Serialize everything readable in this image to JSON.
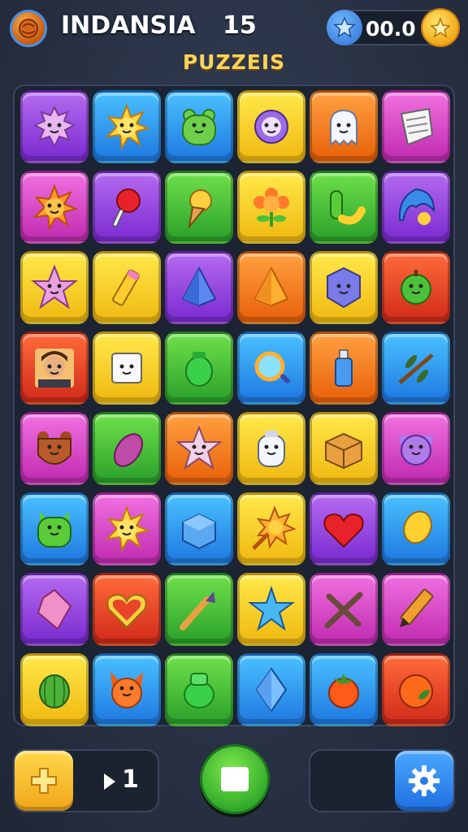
{
  "header": {
    "title": "INDANSIA",
    "level": "15",
    "coins": "00.0",
    "subtitle": "PUZZEIS"
  },
  "colors": {
    "purple": "#9a4ae0",
    "blue": "#2ea0f0",
    "yellow": "#f7d41e",
    "orange": "#f58a1a",
    "pink": "#e854c8",
    "green": "#4cc23a",
    "red": "#e8442a"
  },
  "board": {
    "rows": [
      [
        {
          "color": "purple",
          "icon": "spiky-creature-icon"
        },
        {
          "color": "blue",
          "icon": "sun-icon"
        },
        {
          "color": "blue",
          "icon": "green-frog-icon"
        },
        {
          "color": "yellow",
          "icon": "purple-monster-icon"
        },
        {
          "color": "orange",
          "icon": "ghost-icon"
        },
        {
          "color": "pink",
          "icon": "paper-icon"
        }
      ],
      [
        {
          "color": "pink",
          "icon": "sun-face-icon"
        },
        {
          "color": "purple",
          "icon": "lollipop-icon"
        },
        {
          "color": "green",
          "icon": "ice-cream-icon"
        },
        {
          "color": "yellow",
          "icon": "flower-icon"
        },
        {
          "color": "green",
          "icon": "cactus-banana-icon"
        },
        {
          "color": "purple",
          "icon": "blue-hair-icon"
        }
      ],
      [
        {
          "color": "yellow",
          "icon": "star-creature-icon"
        },
        {
          "color": "yellow",
          "icon": "crayon-icon"
        },
        {
          "color": "purple",
          "icon": "blue-gem-icon"
        },
        {
          "color": "orange",
          "icon": "orange-gem-icon"
        },
        {
          "color": "yellow",
          "icon": "hexagon-face-icon"
        },
        {
          "color": "red",
          "icon": "apple-face-icon"
        }
      ],
      [
        {
          "color": "red",
          "icon": "boy-avatar-icon"
        },
        {
          "color": "yellow",
          "icon": "box-face-icon"
        },
        {
          "color": "green",
          "icon": "green-jar-icon"
        },
        {
          "color": "blue",
          "icon": "magnifier-icon"
        },
        {
          "color": "orange",
          "icon": "bottle-icon"
        },
        {
          "color": "blue",
          "icon": "twig-icon"
        }
      ],
      [
        {
          "color": "pink",
          "icon": "bear-icon"
        },
        {
          "color": "green",
          "icon": "eggplant-icon"
        },
        {
          "color": "orange",
          "icon": "star-critter-icon"
        },
        {
          "color": "yellow",
          "icon": "ghost-jar-icon"
        },
        {
          "color": "yellow",
          "icon": "crate-icon"
        },
        {
          "color": "pink",
          "icon": "purple-blob-icon"
        }
      ],
      [
        {
          "color": "blue",
          "icon": "green-cat-icon"
        },
        {
          "color": "pink",
          "icon": "sun-icon"
        },
        {
          "color": "blue",
          "icon": "ice-cube-icon"
        },
        {
          "color": "yellow",
          "icon": "sun-wand-icon"
        },
        {
          "color": "purple",
          "icon": "heart-icon"
        },
        {
          "color": "blue",
          "icon": "lemon-icon"
        }
      ],
      [
        {
          "color": "purple",
          "icon": "pink-crystal-icon"
        },
        {
          "color": "red",
          "icon": "heart-frame-icon"
        },
        {
          "color": "green",
          "icon": "brush-icon"
        },
        {
          "color": "yellow",
          "icon": "starfish-icon"
        },
        {
          "color": "pink",
          "icon": "sticks-icon"
        },
        {
          "color": "pink",
          "icon": "pencil-icon"
        }
      ],
      [
        {
          "color": "yellow",
          "icon": "watermelon-icon"
        },
        {
          "color": "blue",
          "icon": "fox-face-icon"
        },
        {
          "color": "green",
          "icon": "green-pot-icon"
        },
        {
          "color": "blue",
          "icon": "diamond-icon"
        },
        {
          "color": "blue",
          "icon": "tomato-icon"
        },
        {
          "color": "red",
          "icon": "orange-fruit-icon"
        }
      ]
    ]
  },
  "footer": {
    "counter": "1"
  }
}
